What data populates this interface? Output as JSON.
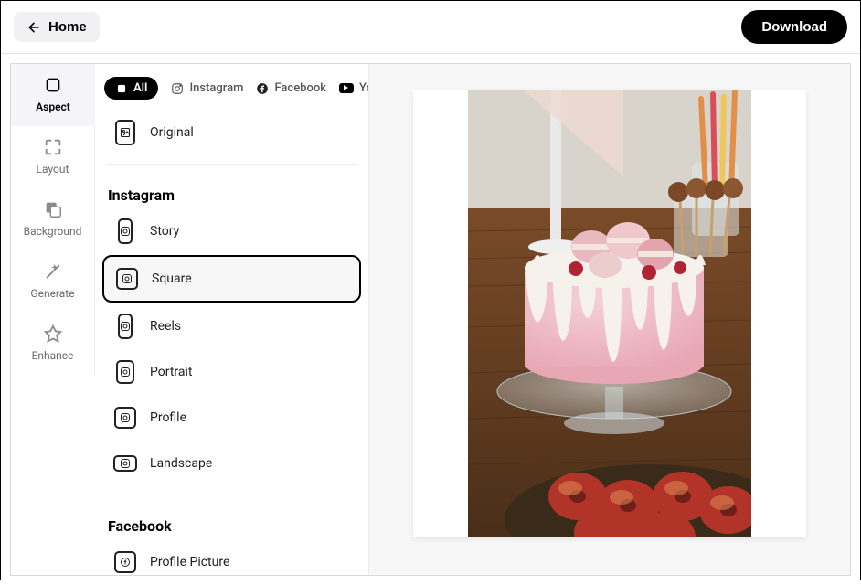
{
  "header": {
    "home": "Home",
    "download": "Download"
  },
  "sidebar": {
    "items": [
      {
        "label": "Aspect"
      },
      {
        "label": "Layout"
      },
      {
        "label": "Background"
      },
      {
        "label": "Generate"
      },
      {
        "label": "Enhance"
      }
    ]
  },
  "filters": {
    "all": "All",
    "instagram": "Instagram",
    "facebook": "Facebook",
    "youtube": "YouTube"
  },
  "aspect": {
    "original": "Original",
    "instagram_title": "Instagram",
    "instagram": {
      "story": "Story",
      "square": "Square",
      "reels": "Reels",
      "portrait": "Portrait",
      "profile": "Profile",
      "landscape": "Landscape"
    },
    "facebook_title": "Facebook",
    "facebook": {
      "profile_picture": "Profile Picture"
    }
  }
}
